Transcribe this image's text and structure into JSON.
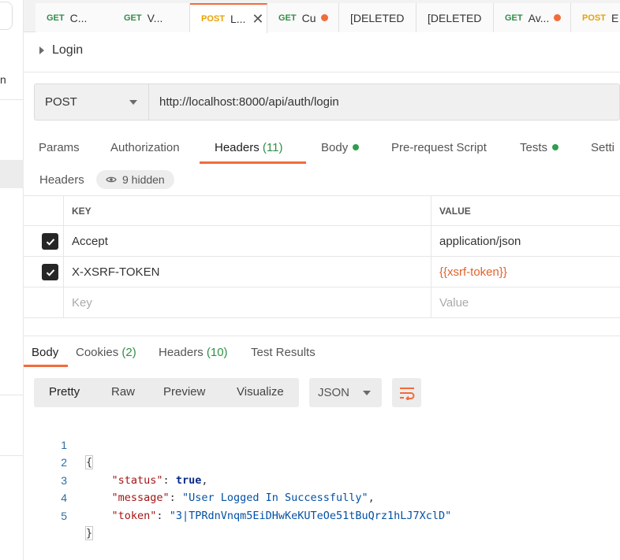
{
  "sidebar": {
    "fragment": "n"
  },
  "tabs": [
    {
      "method": "GET",
      "name": "C..."
    },
    {
      "method": "GET",
      "name": "V..."
    },
    {
      "method": "POST",
      "name": "L..."
    },
    {
      "method": "GET",
      "name": "Cu"
    },
    {
      "method": "",
      "name": "[DELETED"
    },
    {
      "method": "",
      "name": "[DELETED"
    },
    {
      "method": "GET",
      "name": "Av..."
    },
    {
      "method": "POST",
      "name": "E"
    }
  ],
  "request": {
    "title": "Login",
    "method": "POST",
    "url": "http://localhost:8000/api/auth/login"
  },
  "request_tabs": {
    "params": "Params",
    "authorization": "Authorization",
    "headers": "Headers",
    "headers_count": "(11)",
    "body": "Body",
    "prerequest": "Pre-request Script",
    "tests": "Tests",
    "settings": "Setti"
  },
  "headers_section": {
    "label": "Headers",
    "hidden_label": "9 hidden",
    "col_key": "KEY",
    "col_value": "VALUE",
    "rows": [
      {
        "key": "Accept",
        "value": "application/json"
      },
      {
        "key": "X-XSRF-TOKEN",
        "value": "{{xsrf-token}}"
      }
    ],
    "key_placeholder": "Key",
    "value_placeholder": "Value"
  },
  "response_tabs": {
    "body": "Body",
    "cookies": "Cookies",
    "cookies_count": "(2)",
    "headers": "Headers",
    "headers_count": "(10)",
    "test_results": "Test Results"
  },
  "view_options": {
    "pretty": "Pretty",
    "raw": "Raw",
    "preview": "Preview",
    "visualize": "Visualize",
    "format": "JSON"
  },
  "response_body": {
    "line_numbers": [
      "1",
      "2",
      "3",
      "4",
      "5"
    ],
    "open_brace": "{",
    "close_brace": "}",
    "status_key": "\"status\"",
    "status_value": "true",
    "message_key": "\"message\"",
    "message_value": "\"User Logged In Successfully\"",
    "token_key": "\"token\"",
    "token_value": "\"3|TPRdnVnqm5EiDHwKeKUTeOe51tBuQrz1hLJ7XclD\""
  },
  "colors": {
    "accent": "#f26b3a",
    "get": "#2f8f46",
    "post": "#e8a200"
  }
}
